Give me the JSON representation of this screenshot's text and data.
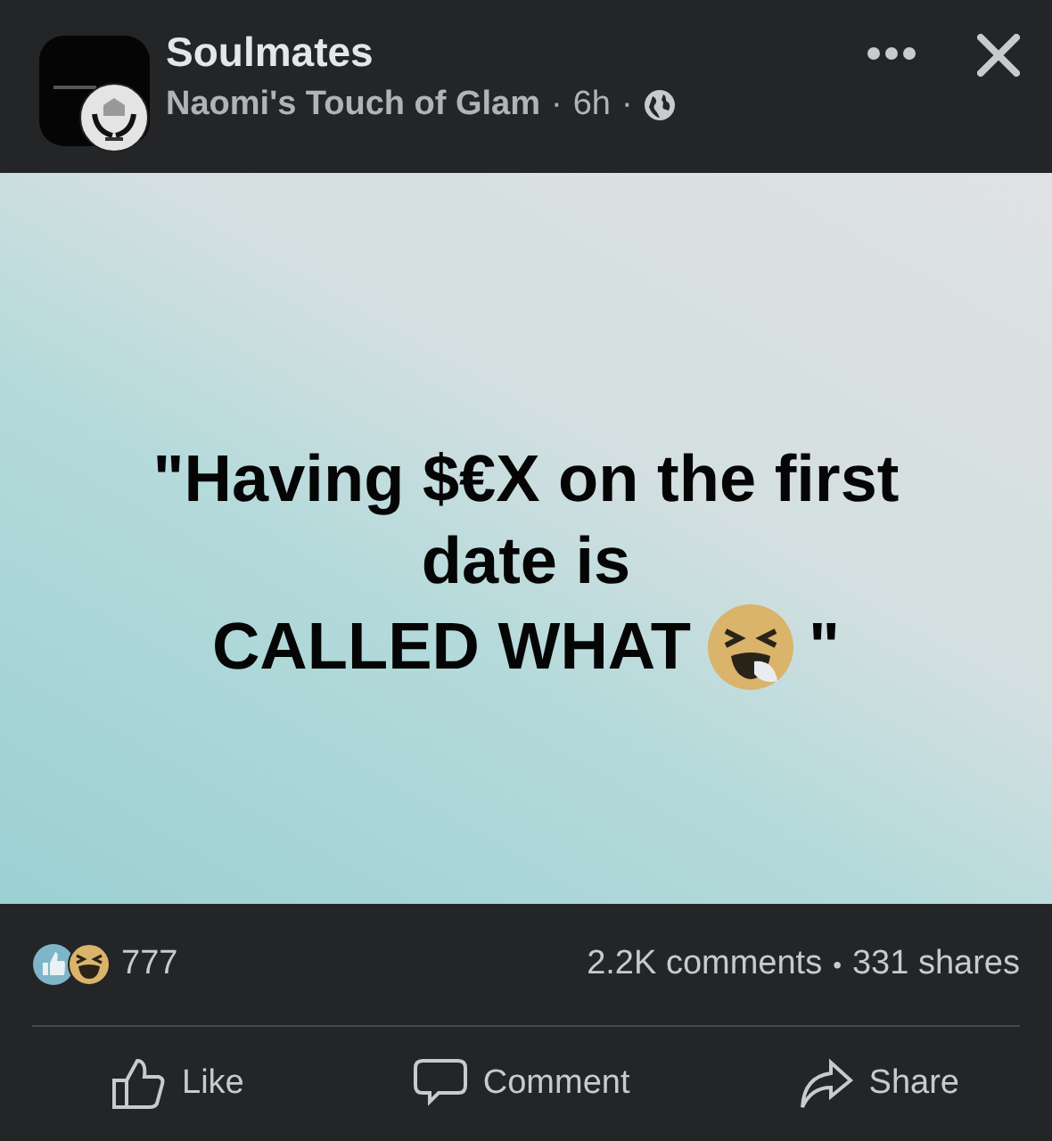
{
  "header": {
    "group": "Soulmates",
    "author": "Naomi's Touch of Glam",
    "separator_1": "·",
    "time": "6h",
    "separator_2": "·"
  },
  "post": {
    "lines": [
      "\"Having $€X on the first",
      "date is",
      "CALLED WHAT"
    ],
    "closing": "\""
  },
  "stats": {
    "reactions": "777",
    "comments": "2.2K comments",
    "dot": "•",
    "shares": "331 shares"
  },
  "actions": [
    {
      "kind": "like",
      "label": "Like"
    },
    {
      "kind": "comment",
      "label": "Comment"
    },
    {
      "kind": "share",
      "label": "Share"
    }
  ]
}
